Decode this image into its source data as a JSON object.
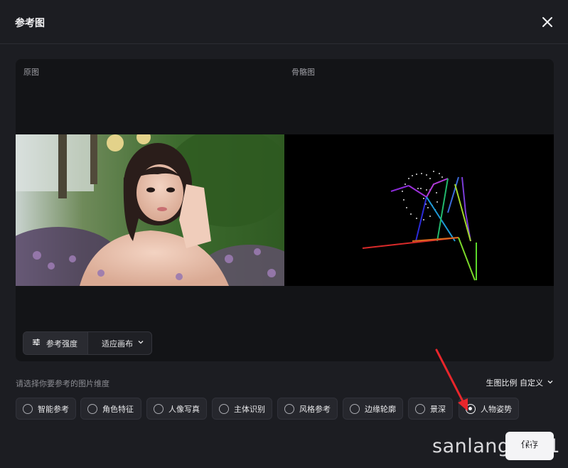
{
  "dialog": {
    "title": "参考图",
    "close_icon": "close-icon"
  },
  "preview": {
    "original_label": "原图",
    "skeleton_label": "骨骼图"
  },
  "toolbar": {
    "strength_label": "参考强度",
    "strength_icon": "sliders-icon",
    "fit_label": "适应画布",
    "fit_icon": "chevron-down-icon"
  },
  "dimension": {
    "hint": "请选择你要参考的图片维度",
    "ratio_label": "生图比例 自定义",
    "ratio_icon": "chevron-down-icon",
    "options": [
      {
        "label": "智能参考",
        "selected": false
      },
      {
        "label": "角色特征",
        "selected": false
      },
      {
        "label": "人像写真",
        "selected": false
      },
      {
        "label": "主体识别",
        "selected": false
      },
      {
        "label": "风格参考",
        "selected": false
      },
      {
        "label": "边缘轮廓",
        "selected": false
      },
      {
        "label": "景深",
        "selected": false
      },
      {
        "label": "人物姿势",
        "selected": true
      }
    ]
  },
  "actions": {
    "save_label": "保存"
  },
  "watermark": "sanlang2021",
  "colors": {
    "annotation_arrow": "#e8262b",
    "background": "#1c1d22",
    "accent": "#f4f4f6"
  }
}
